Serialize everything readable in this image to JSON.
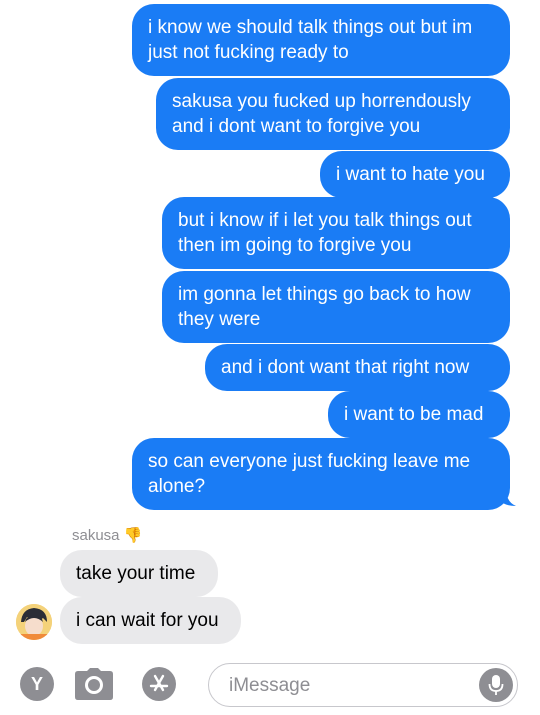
{
  "conversation": {
    "outgoing": [
      "i know we should talk things out but im\njust not fucking ready to",
      "sakusa you fucked up horrendously\nand i dont want to forgive you",
      "i want to hate you",
      "but i know if i let you talk things out\nthen im going to forgive you",
      "im gonna let things go back to how\nthey were",
      "and i dont want that right now",
      "i want to be mad",
      "so can everyone just fucking leave me\nalone?"
    ],
    "sender_name": "sakusa",
    "reaction_emoji": "👎",
    "incoming": [
      "take your time",
      "i can wait for you"
    ]
  },
  "composer": {
    "left_button_letter": "Y",
    "placeholder": "iMessage"
  },
  "colors": {
    "outgoing_bubble": "#1a7cf5",
    "incoming_bubble": "#e9e9eb",
    "muted_gray": "#8e8e93"
  }
}
